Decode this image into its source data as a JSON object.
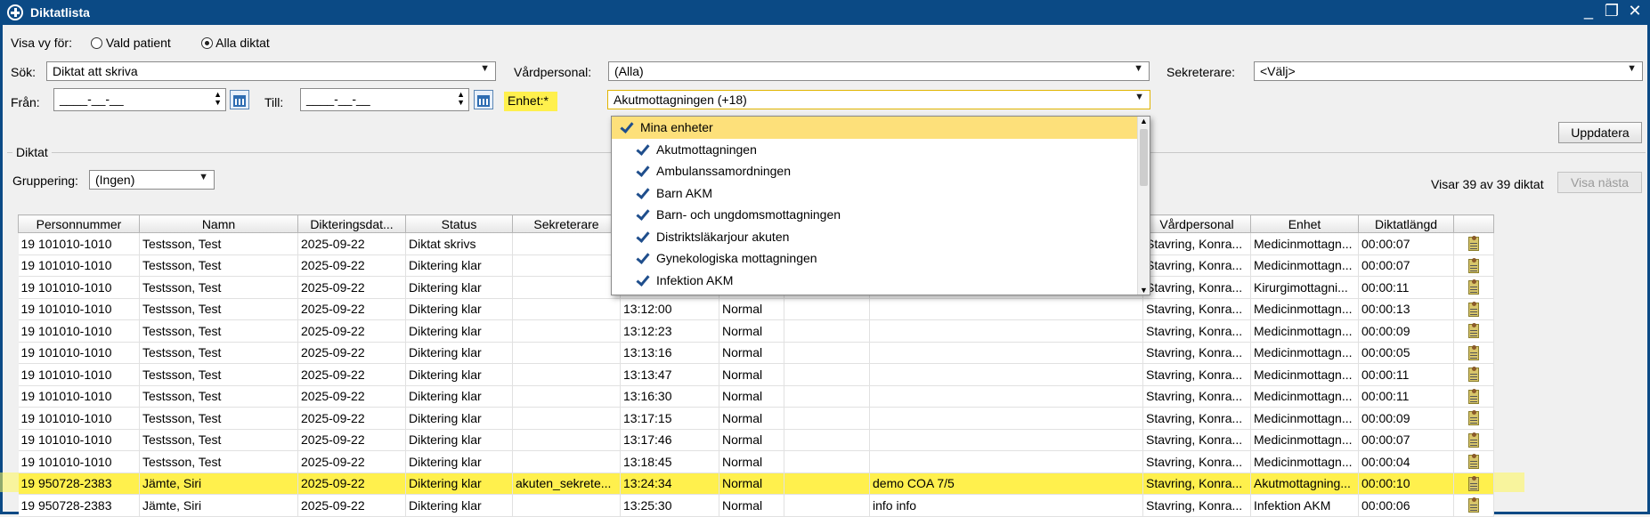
{
  "window": {
    "title": "Diktatlista"
  },
  "view": {
    "label": "Visa vy för:",
    "opt1": "Vald patient",
    "opt2": "Alla diktat"
  },
  "filters": {
    "sok_label": "Sök:",
    "sok_value": "Diktat att skriva",
    "vardpersonal_label": "Vårdpersonal:",
    "vardpersonal_value": "(Alla)",
    "sekreterare_label": "Sekreterare:",
    "sekreterare_value": "<Välj>",
    "fran_label": "Från:",
    "fran_value": "____-__-__",
    "till_label": "Till:",
    "till_value": "____-__-__",
    "enhet_label": "Enhet:*",
    "enhet_value": "Akutmottagningen (+18)"
  },
  "buttons": {
    "uppdatera": "Uppdatera",
    "visa_nasta": "Visa nästa"
  },
  "group": {
    "title": "Diktat",
    "gruppering_label": "Gruppering:",
    "gruppering_value": "(Ingen)",
    "count_text": "Visar 39 av 39 diktat"
  },
  "dropdown": {
    "header": "Mina enheter",
    "items": [
      "Akutmottagningen",
      "Ambulanssamordningen",
      "Barn AKM",
      "Barn- och ungdomsmottagningen",
      "Distriktsläkarjour akuten",
      "Gynekologiska mottagningen",
      "Infektion AKM"
    ]
  },
  "columns": [
    "Personnummer",
    "Namn",
    "Dikteringsdat...",
    "Status",
    "Sekreterare",
    "",
    "",
    "",
    "",
    "Vårdpersonal",
    "Enhet",
    "Diktatlängd",
    ""
  ],
  "rows": [
    [
      "19 101010-1010",
      "Testsson, Test",
      "2025-09-22",
      "Diktat skrivs",
      "",
      "",
      "",
      "",
      "",
      "Stavring, Konra...",
      "Medicinmottagn...",
      "00:00:07"
    ],
    [
      "19 101010-1010",
      "Testsson, Test",
      "2025-09-22",
      "Diktering klar",
      "",
      "",
      "",
      "",
      "",
      "Stavring, Konra...",
      "Medicinmottagn...",
      "00:00:07"
    ],
    [
      "19 101010-1010",
      "Testsson, Test",
      "2025-09-22",
      "Diktering klar",
      "",
      "",
      "",
      "",
      "",
      "Stavring, Konra...",
      "Kirurgimottagni...",
      "00:00:11"
    ],
    [
      "19 101010-1010",
      "Testsson, Test",
      "2025-09-22",
      "Diktering klar",
      "",
      "13:12:00",
      "Normal",
      "",
      "",
      "Stavring, Konra...",
      "Medicinmottagn...",
      "00:00:13"
    ],
    [
      "19 101010-1010",
      "Testsson, Test",
      "2025-09-22",
      "Diktering klar",
      "",
      "13:12:23",
      "Normal",
      "",
      "",
      "Stavring, Konra...",
      "Medicinmottagn...",
      "00:00:09"
    ],
    [
      "19 101010-1010",
      "Testsson, Test",
      "2025-09-22",
      "Diktering klar",
      "",
      "13:13:16",
      "Normal",
      "",
      "",
      "Stavring, Konra...",
      "Medicinmottagn...",
      "00:00:05"
    ],
    [
      "19 101010-1010",
      "Testsson, Test",
      "2025-09-22",
      "Diktering klar",
      "",
      "13:13:47",
      "Normal",
      "",
      "",
      "Stavring, Konra...",
      "Medicinmottagn...",
      "00:00:11"
    ],
    [
      "19 101010-1010",
      "Testsson, Test",
      "2025-09-22",
      "Diktering klar",
      "",
      "13:16:30",
      "Normal",
      "",
      "",
      "Stavring, Konra...",
      "Medicinmottagn...",
      "00:00:11"
    ],
    [
      "19 101010-1010",
      "Testsson, Test",
      "2025-09-22",
      "Diktering klar",
      "",
      "13:17:15",
      "Normal",
      "",
      "",
      "Stavring, Konra...",
      "Medicinmottagn...",
      "00:00:09"
    ],
    [
      "19 101010-1010",
      "Testsson, Test",
      "2025-09-22",
      "Diktering klar",
      "",
      "13:17:46",
      "Normal",
      "",
      "",
      "Stavring, Konra...",
      "Medicinmottagn...",
      "00:00:07"
    ],
    [
      "19 101010-1010",
      "Testsson, Test",
      "2025-09-22",
      "Diktering klar",
      "",
      "13:18:45",
      "Normal",
      "",
      "",
      "Stavring, Konra...",
      "Medicinmottagn...",
      "00:00:04"
    ],
    [
      "19 950728-2383",
      "Jämte, Siri",
      "2025-09-22",
      "Diktering klar",
      "akuten_sekrete...",
      "13:24:34",
      "Normal",
      "",
      "demo COA 7/5",
      "Stavring, Konra...",
      "Akutmottagning...",
      "00:00:10"
    ],
    [
      "19 950728-2383",
      "Jämte, Siri",
      "2025-09-22",
      "Diktering klar",
      "",
      "13:25:30",
      "Normal",
      "",
      "info info",
      "Stavring, Konra...",
      "Infektion AKM",
      "00:00:06"
    ]
  ],
  "highlight_row": 11
}
